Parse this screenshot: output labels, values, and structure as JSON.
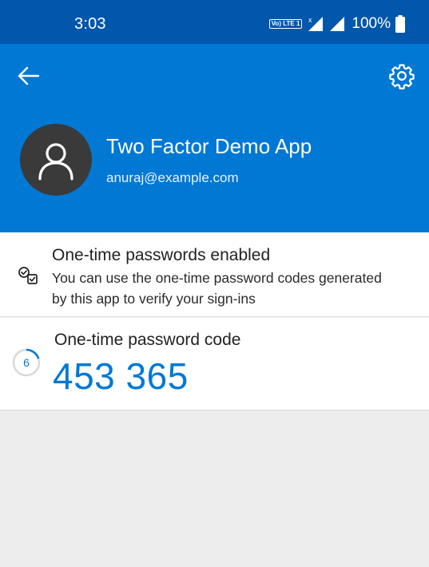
{
  "status_bar": {
    "time": "3:03",
    "network_badge": "Vo) LTE 1",
    "battery": "100%"
  },
  "header": {
    "account_name": "Two Factor Demo App",
    "account_email": "anuraj@example.com",
    "background_color": "#0078d4",
    "icons": {
      "back": "arrow-left-icon",
      "settings": "gear-icon",
      "avatar": "person-icon"
    }
  },
  "otp_enabled": {
    "title": "One-time passwords enabled",
    "description": "You can use the one-time password codes generated by this app to verify your sign-ins",
    "icon": "checklist-icon"
  },
  "otp_code": {
    "label": "One-time password code",
    "code": "453 365",
    "seconds_remaining": "6",
    "timer_fraction_remaining": 0.2,
    "accent_color": "#0078d4"
  }
}
